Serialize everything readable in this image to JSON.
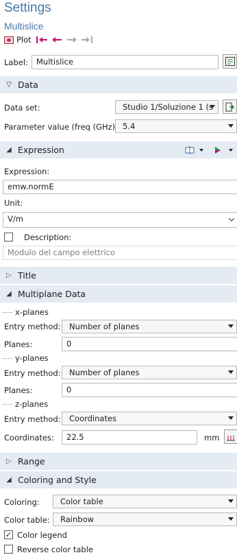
{
  "header": {
    "title": "Settings",
    "subtitle": "Multislice",
    "plot_label": "Plot"
  },
  "label_row": {
    "label": "Label:",
    "value": "Multislice"
  },
  "data_section": {
    "title": "Data",
    "dataset_label": "Data set:",
    "dataset_value": "Studio 1/Soluzione 1 (s",
    "param_label": "Parameter value (freq (GHz)):",
    "param_value": "5.4"
  },
  "expression_section": {
    "title": "Expression",
    "expr_label": "Expression:",
    "expr_value": "emw.normE",
    "unit_label": "Unit:",
    "unit_value": "V/m",
    "desc_label": "Description:",
    "desc_value": "Modulo del campo elettrico"
  },
  "title_section": {
    "title": "Title"
  },
  "multiplane": {
    "title": "Multiplane Data",
    "x": {
      "group": "x-planes",
      "entry_label": "Entry method:",
      "entry_value": "Number of planes",
      "planes_label": "Planes:",
      "planes_value": "0"
    },
    "y": {
      "group": "y-planes",
      "entry_label": "Entry method:",
      "entry_value": "Number of planes",
      "planes_label": "Planes:",
      "planes_value": "0"
    },
    "z": {
      "group": "z-planes",
      "entry_label": "Entry method:",
      "entry_value": "Coordinates",
      "coords_label": "Coordinates:",
      "coords_value": "22.5",
      "unit": "mm"
    }
  },
  "range_section": {
    "title": "Range"
  },
  "coloring": {
    "title": "Coloring and Style",
    "coloring_label": "Coloring:",
    "coloring_value": "Color table",
    "table_label": "Color table:",
    "table_value": "Rainbow",
    "legend_label": "Color legend",
    "reverse_label": "Reverse color table",
    "legend_checked": true,
    "reverse_checked": false
  },
  "colors": {
    "accent": "#4a78a8",
    "section_bg": "#e4ebf3",
    "magenta": "#c0106a"
  }
}
